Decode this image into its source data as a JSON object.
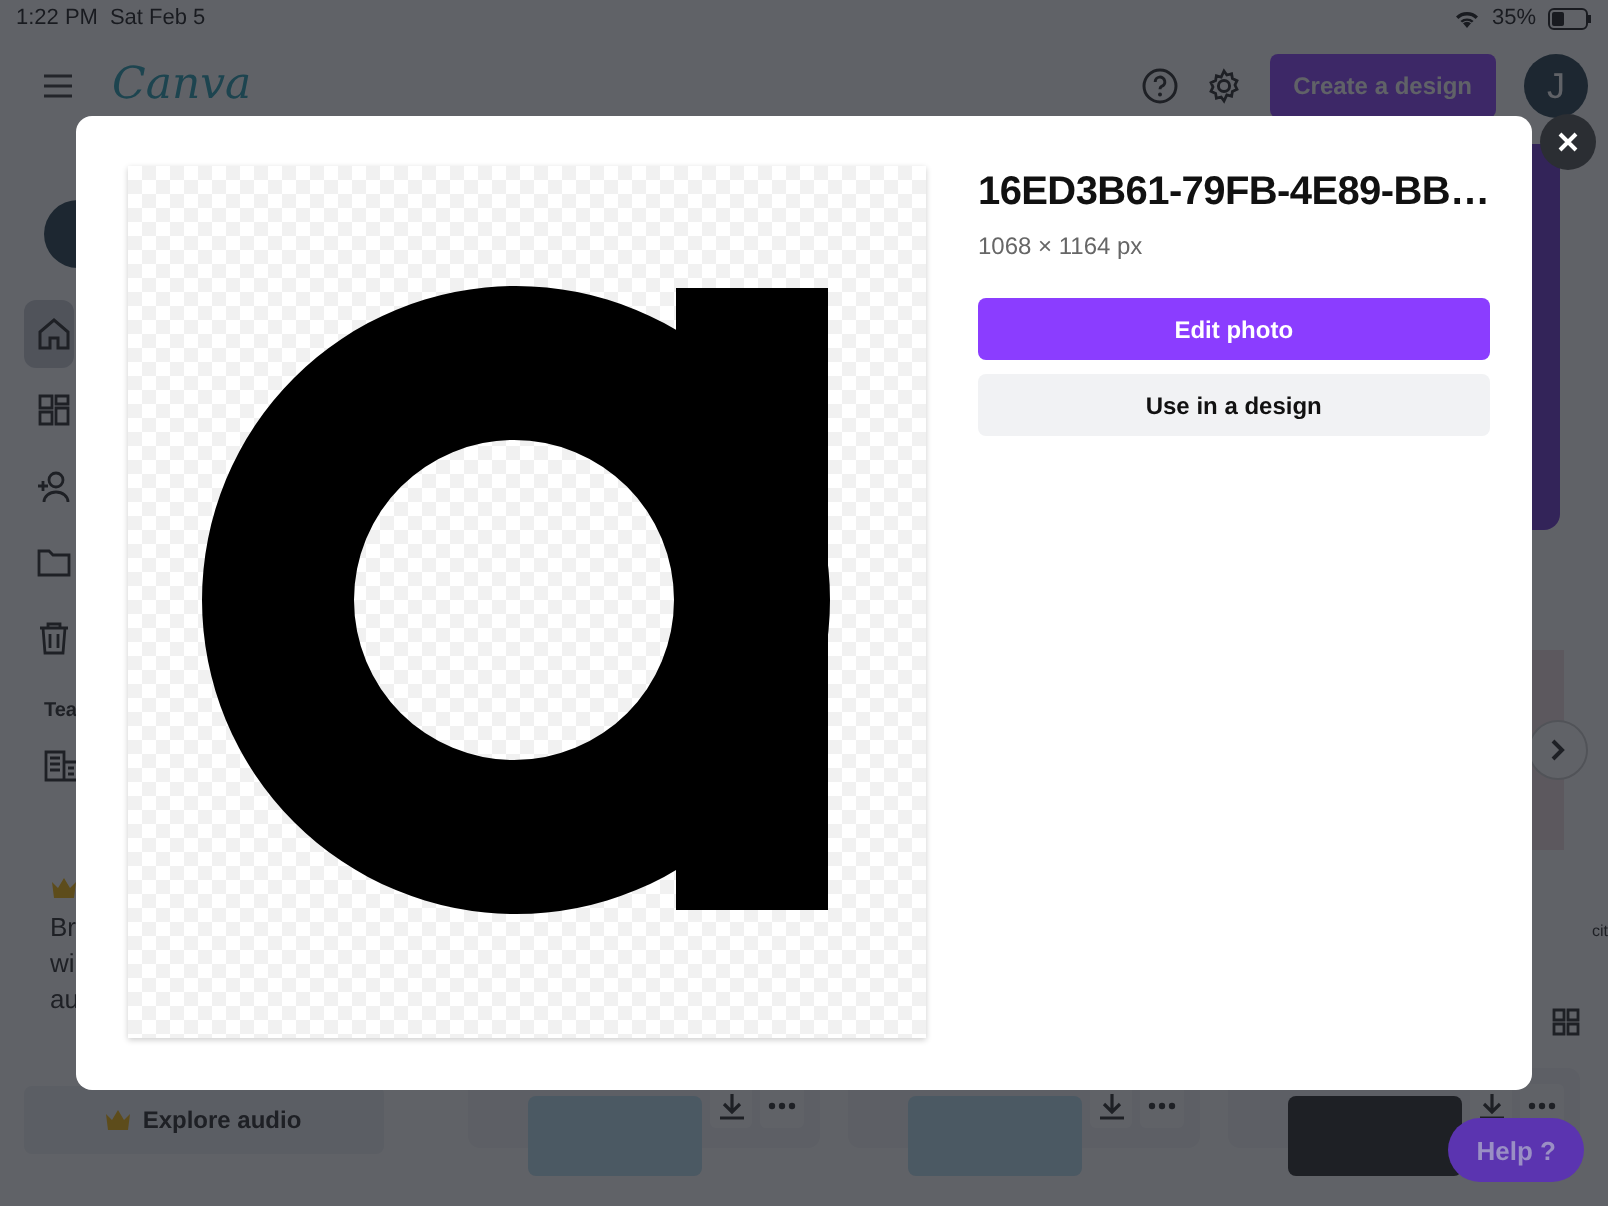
{
  "status_bar": {
    "time": "1:22 PM",
    "date": "Sat Feb 5",
    "battery": "35%"
  },
  "header": {
    "logo": "Canva",
    "create_button": "Create a design",
    "avatar": "J"
  },
  "sidebar": {
    "items": [
      {
        "selected": true
      },
      {
        "selected": false
      },
      {
        "selected": false
      },
      {
        "selected": false
      },
      {
        "selected": false
      }
    ],
    "team_label": "Tea",
    "promo_lines": [
      "Br",
      "wi",
      "au"
    ],
    "explore_button": "Explore audio"
  },
  "main": {
    "side_text": "cit",
    "help_button": "Help ?"
  },
  "modal": {
    "title": "16ED3B61-79FB-4E89-BB…",
    "dimensions": "1068 × 1164 px",
    "primary_button": "Edit photo",
    "secondary_button": "Use in a design"
  }
}
